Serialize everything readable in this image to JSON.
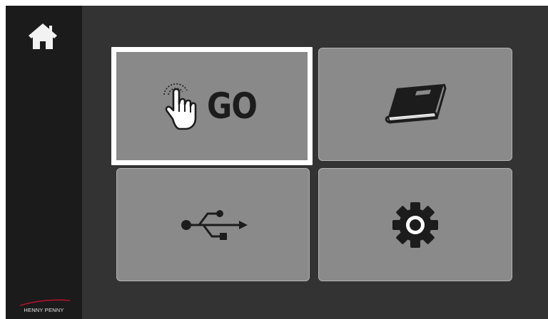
{
  "sidebar": {
    "home_icon": "home-icon",
    "logo_text": "HENNY PENNY"
  },
  "tiles": [
    {
      "id": "go",
      "label": "GO",
      "icon": "hand-touch-icon",
      "selected": true
    },
    {
      "id": "manual",
      "label": "",
      "icon": "book-icon",
      "selected": false
    },
    {
      "id": "usb",
      "label": "",
      "icon": "usb-icon",
      "selected": false
    },
    {
      "id": "settings",
      "label": "",
      "icon": "gear-icon",
      "selected": false
    }
  ],
  "colors": {
    "background": "#333333",
    "sidebar": "#1b1b1b",
    "tile": "#8a8a8a",
    "tile_border": "#b3b3b3",
    "selection": "#ffffff",
    "icon": "#1c1c1c",
    "logo_accent": "#c8102e"
  }
}
